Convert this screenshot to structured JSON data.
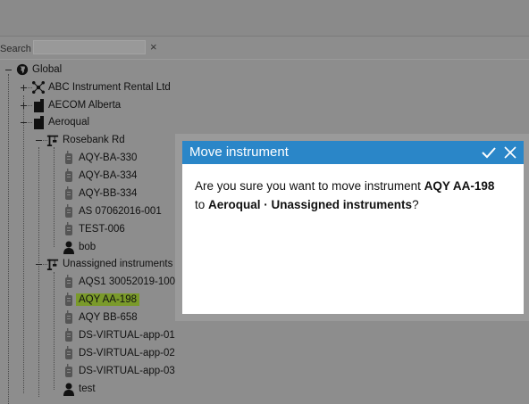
{
  "search": {
    "label": "Search",
    "value": "",
    "clear_glyph": "×"
  },
  "tree": {
    "root": "Global",
    "abc": "ABC Instrument Rental Ltd",
    "aecom": "AECOM Alberta",
    "aeroqual": "Aeroqual",
    "rosebank": "Rosebank Rd",
    "rosebank_items": [
      "AQY-BA-330",
      "AQY-BA-334",
      "AQY-BB-334",
      "AS 07062016-001",
      "TEST-006"
    ],
    "rosebank_user": "bob",
    "unassigned": "Unassigned instruments",
    "unassigned_items": [
      "AQS1 30052019-1003",
      "AQY AA-198",
      "AQY BB-658",
      "DS-VIRTUAL-app-01",
      "DS-VIRTUAL-app-02",
      "DS-VIRTUAL-app-03"
    ],
    "unassigned_user": "test",
    "selected": "AQY AA-198"
  },
  "dialog": {
    "title": "Move instrument",
    "msg_prefix": "Are you sure you want to move instrument ",
    "msg_instrument": "AQY AA-198",
    "msg_mid": " to ",
    "msg_destination": "Aeroqual · Unassigned instruments",
    "msg_suffix": "?"
  },
  "colors": {
    "header": "#2a86c8",
    "selection": "#7a9a2a",
    "overlay": "#8d8d8d"
  },
  "icons": {
    "ok": "check-icon",
    "close": "close-icon",
    "globe": "globe-icon",
    "org": "building-icon",
    "site": "crane-icon",
    "instrument": "instrument-icon",
    "user": "user-icon",
    "network": "network-icon"
  }
}
